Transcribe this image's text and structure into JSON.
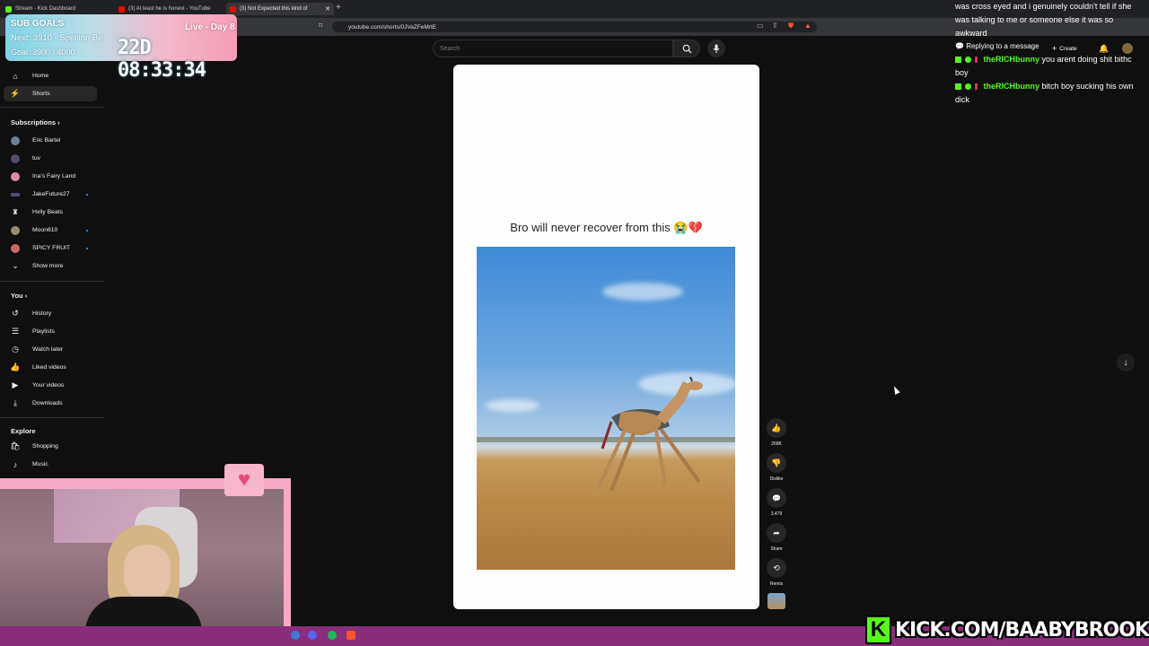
{
  "browser": {
    "tabs": [
      {
        "title": "Stream - Kick Dashboard"
      },
      {
        "title": "(3) At least he is honest - YouTube"
      },
      {
        "title": "(3) Not Expected this kind of"
      }
    ],
    "url": "youtube.com/shorts/0JVaZFeMrtE"
  },
  "overlay": {
    "title": "SUB GOALS",
    "next": "Next: 3910 - Spelling Be",
    "goal": "Goal: 3900 / 4000",
    "live": "Live - Day 8",
    "timer": "22D  08:33:34"
  },
  "sidebar": {
    "nav": [
      {
        "label": "Home"
      },
      {
        "label": "Shorts"
      }
    ],
    "subscriptions_label": "Subscriptions",
    "subscriptions": [
      {
        "label": "Eric Bartel"
      },
      {
        "label": "tuv"
      },
      {
        "label": "Ina's Fairy Land"
      },
      {
        "label": "JakeFuture27"
      },
      {
        "label": "Hxlly Beats"
      },
      {
        "label": "Moon610"
      },
      {
        "label": "SPICY FRUIT"
      }
    ],
    "show_more": "Show more",
    "you_label": "You",
    "you": [
      {
        "label": "History"
      },
      {
        "label": "Playlists"
      },
      {
        "label": "Watch later"
      },
      {
        "label": "Liked videos"
      },
      {
        "label": "Your videos"
      },
      {
        "label": "Downloads"
      }
    ],
    "explore_label": "Explore",
    "explore": [
      {
        "label": "Shopping"
      },
      {
        "label": "Music"
      }
    ]
  },
  "search": {
    "placeholder": "Search"
  },
  "short": {
    "caption": "Bro will never recover from this 😭💔",
    "likes": "268K",
    "dislike": "Dislike",
    "comments": "3,479",
    "share": "Share",
    "remix": "Remix"
  },
  "header": {
    "create": "Create"
  },
  "chat": {
    "prev": "was cross eyed and i genuinely couldn't tell if she was talking to me or someone else it was so awkward",
    "reply": "Replying to a message",
    "messages": [
      {
        "user": "theRICHbunny",
        "text": "you arent doing shit bithc boy"
      },
      {
        "user": "theRICHbunny",
        "text": "bitch boy sucking his own dick"
      }
    ]
  },
  "banner": {
    "text": "KICK.COM/BAABYBROOK"
  },
  "colors": {
    "kick_green": "#53fc18",
    "yt_bg": "#0f0f0f",
    "taskbar": "#8a2d7a"
  }
}
